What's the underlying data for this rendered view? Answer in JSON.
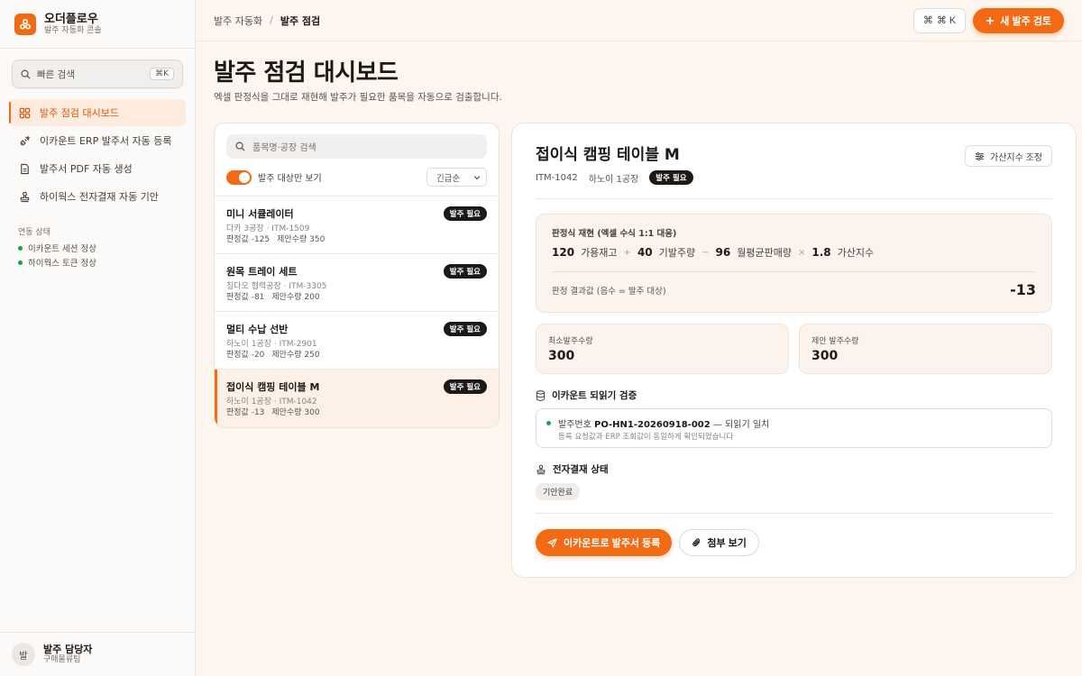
{
  "brand": {
    "name": "오더플로우",
    "subtitle": "발주 자동화 콘솔"
  },
  "quick_search": {
    "placeholder": "빠른 검색",
    "shortcut": "⌘K"
  },
  "nav": [
    {
      "label": "발주 점검 대시보드",
      "icon": "dashboard-icon",
      "active": true
    },
    {
      "label": "이카운트 ERP 발주서 자동 등록",
      "icon": "plug-icon",
      "active": false
    },
    {
      "label": "발주서 PDF 자동 생성",
      "icon": "document-icon",
      "active": false
    },
    {
      "label": "하이웍스 전자결재 자동 기안",
      "icon": "stamp-icon",
      "active": false
    }
  ],
  "integration_status": {
    "title": "연동 상태",
    "items": [
      "이카운트 세션 정상",
      "하이웍스 토큰 정상"
    ]
  },
  "user": {
    "initial": "발",
    "name": "발주 담당자",
    "role": "구매물류팀"
  },
  "breadcrumb": {
    "parent": "발주 자동화",
    "separator": "/",
    "current": "발주 점검"
  },
  "topbar": {
    "shortcut_label": "⌘ K",
    "new_button": "새 발주 검토"
  },
  "page": {
    "title": "발주 점검 대시보드",
    "subtitle": "엑셀 판정식을 그대로 재현해 발주가 필요한 품목을 자동으로 검출합니다."
  },
  "list": {
    "search_placeholder": "품목명·공장 검색",
    "toggle_label": "발주 대상만 보기",
    "sort_value": "긴급순",
    "items": [
      {
        "name": "미니 서큘레이터",
        "meta": "다카 3공장 · ITM-1509",
        "judgment": "판정값 -125",
        "proposal": "제안수량 350",
        "badge": "발주 필요"
      },
      {
        "name": "원목 트레이 세트",
        "meta": "칭다오 협력공장 · ITM-3305",
        "judgment": "판정값 -81",
        "proposal": "제안수량 200",
        "badge": "발주 필요"
      },
      {
        "name": "멀티 수납 선반",
        "meta": "하노이 1공장 · ITM-2901",
        "judgment": "판정값 -20",
        "proposal": "제안수량 250",
        "badge": "발주 필요"
      },
      {
        "name": "접이식 캠핑 테이블 M",
        "meta": "하노이 1공장 · ITM-1042",
        "judgment": "판정값 -13",
        "proposal": "제안수량 300",
        "badge": "발주 필요"
      }
    ]
  },
  "detail": {
    "title": "접이식 캠핑 테이블 M",
    "code": "ITM-1042",
    "factory": "하노이 1공장",
    "badge": "발주 필요",
    "adjust_button": "가산지수 조정",
    "formula": {
      "title": "판정식 재현 (엑셀 수식 1:1 대응)",
      "terms": [
        {
          "value": "120",
          "label": "가용재고"
        },
        {
          "op": "+"
        },
        {
          "value": "40",
          "label": "기발주량"
        },
        {
          "op": "−"
        },
        {
          "value": "96",
          "label": "월평균판매량"
        },
        {
          "op": "×"
        },
        {
          "value": "1.8",
          "label": "가산지수"
        }
      ],
      "result_label": "판정 결과값 (음수 = 발주 대상)",
      "result_value": "-13"
    },
    "min_qty": {
      "label": "최소발주수량",
      "value": "300"
    },
    "proposed_qty": {
      "label": "제안 발주수량",
      "value": "300"
    },
    "verify": {
      "title": "이카운트 되읽기 검증",
      "prefix": "발주번호",
      "po_number": "PO-HN1-20260918-002",
      "suffix": "— 되읽기 일치",
      "note": "등록 요청값과 ERP 조회값이 동일하게 확인되었습니다"
    },
    "approval": {
      "title": "전자결재 상태",
      "status": "기안완료"
    },
    "actions": {
      "register": "이카운트로 발주서 등록",
      "attach": "첨부 보기"
    }
  },
  "colors": {
    "accent": "#f26a13",
    "ok": "#16a34a",
    "badge_bg": "#1c1917"
  }
}
